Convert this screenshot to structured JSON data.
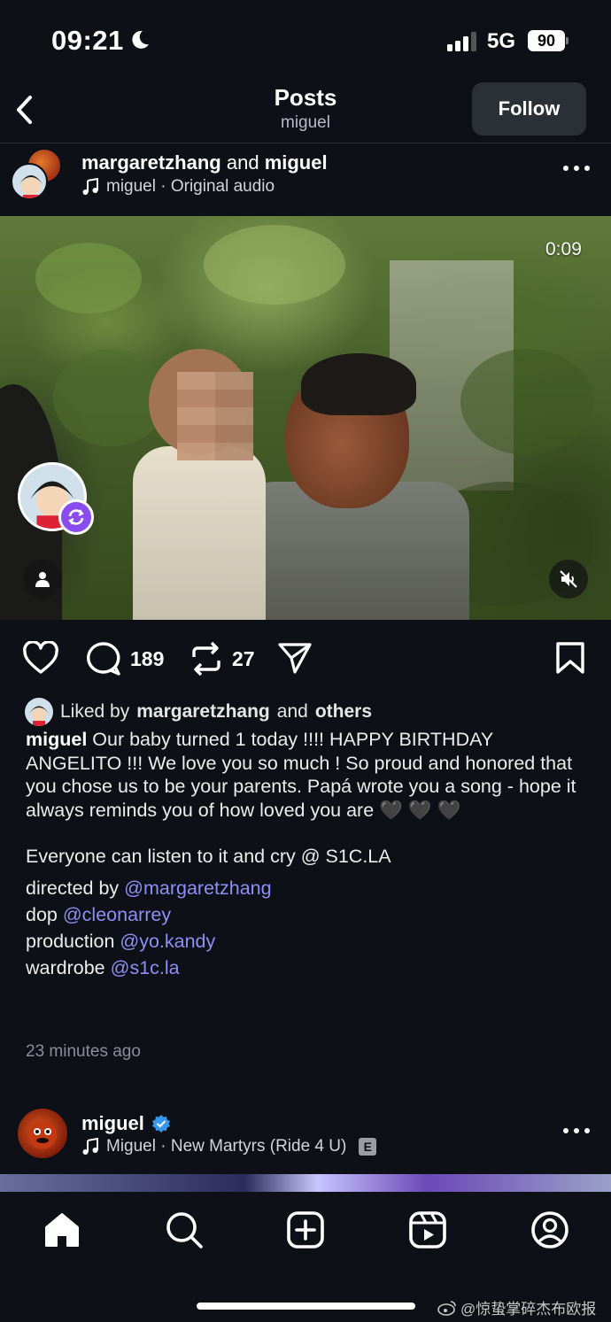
{
  "status": {
    "time": "09:21",
    "network": "5G",
    "battery": "90"
  },
  "nav": {
    "title": "Posts",
    "subtitle": "miguel",
    "follow_label": "Follow"
  },
  "post": {
    "author_a": "margaretzhang",
    "joiner": "and",
    "author_b": "miguel",
    "audio": "miguel · Original audio",
    "timer": "0:09",
    "comments_count": "189",
    "reposts_count": "27",
    "liked_prefix": "Liked by",
    "liked_user": "margaretzhang",
    "liked_mid": "and",
    "liked_others": "others",
    "caption_author": "miguel",
    "caption_text": "Our baby turned 1 today !!!! HAPPY BIRTHDAY ANGELITO !!! We love you so much ! So proud and honored that you chose us to be your parents. Papá wrote you a song - hope it always reminds you of how loved you are 🖤 🖤 🖤",
    "caption_line2": "Everyone can listen to it and cry @ S1C.LA",
    "credits": [
      {
        "label": "directed by",
        "mention": "@margaretzhang"
      },
      {
        "label": "dop",
        "mention": "@cleonarrey"
      },
      {
        "label": "production",
        "mention": "@yo.kandy"
      },
      {
        "label": "wardrobe",
        "mention": "@s1c.la"
      }
    ],
    "time_ago": "23 minutes ago"
  },
  "next_post": {
    "author": "miguel",
    "audio": "Miguel · New Martyrs (Ride 4 U)",
    "explicit": "E"
  },
  "watermark": "@惊蛰掌碎杰布欧报",
  "colors": {
    "background": "#0d1016",
    "mention": "#8f8ff5",
    "remix_badge": "#8a4cf0",
    "verified": "#3897f0"
  }
}
